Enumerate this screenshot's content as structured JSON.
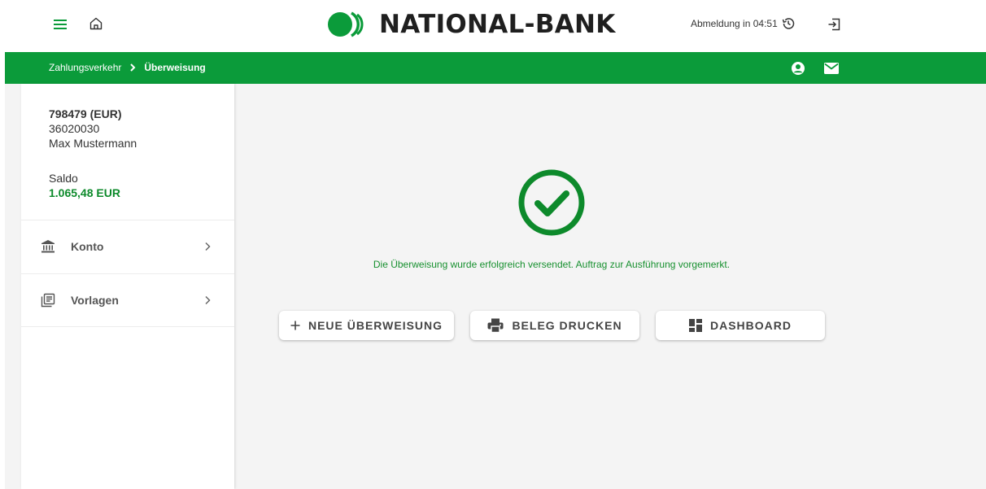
{
  "header": {
    "logo_text": "NATIONAL-BANK",
    "logout_timer": "Abmeldung in 04:51"
  },
  "breadcrumb": {
    "parent": "Zahlungsverkehr",
    "current": "Überweisung"
  },
  "sidebar": {
    "account_number": "798479 (EUR)",
    "bank_code": "36020030",
    "holder": "Max Mustermann",
    "balance_label": "Saldo",
    "balance_value": "1.065,48 EUR",
    "items": [
      {
        "label": "Konto",
        "icon": "bank-icon"
      },
      {
        "label": "Vorlagen",
        "icon": "templates-icon"
      }
    ]
  },
  "content": {
    "success_message": "Die Überweisung wurde erfolgreich versendet. Auftrag zur Ausführung vorgemerkt.",
    "buttons": {
      "new_transfer": "NEUE ÜBERWEISUNG",
      "print_receipt": "BELEG DRUCKEN",
      "dashboard": "DASHBOARD"
    }
  },
  "colors": {
    "brand_green": "#0b9b3a",
    "success_green": "#17902f",
    "balance_green": "#0d8a2b"
  }
}
